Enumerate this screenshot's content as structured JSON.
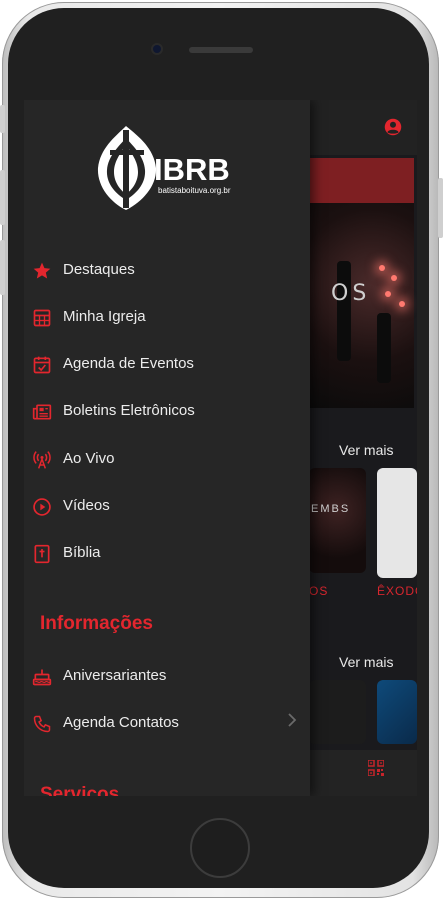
{
  "colors": {
    "accent": "#e3262e",
    "drawer_bg": "#262626",
    "menu_text": "#ececec",
    "app_bg": "#1a1a1d",
    "banner": "#7e1f22"
  },
  "logo": {
    "text": "IBRB",
    "subtext": "batistaboituva.org.br"
  },
  "menu": [
    {
      "label": "Destaques",
      "icon": "star-icon"
    },
    {
      "label": "Minha Igreja",
      "icon": "calendar-grid-icon"
    },
    {
      "label": "Agenda de Eventos",
      "icon": "calendar-check-icon"
    },
    {
      "label": "Boletins Eletrônicos",
      "icon": "newspaper-icon"
    },
    {
      "label": "Ao Vivo",
      "icon": "broadcast-antenna-icon"
    },
    {
      "label": "Vídeos",
      "icon": "play-circle-icon"
    },
    {
      "label": "Bíblia",
      "icon": "bible-icon"
    }
  ],
  "sections": {
    "info_title": "Informações",
    "services_title": "Serviços"
  },
  "info_menu": [
    {
      "label": "Aniversariantes",
      "icon": "birthday-cake-icon"
    },
    {
      "label": "Agenda Contatos",
      "icon": "phone-icon"
    }
  ],
  "background": {
    "hero_text": "OS",
    "see_more_1": "Ver mais",
    "see_more_2": "Ver mais",
    "thumb_label_1": "OS",
    "thumb_label_2": "ÊXODO",
    "thumb_overlay_text": "EMBS",
    "profile_icon": "account-circle-icon",
    "qr_icon": "qr-code-icon"
  }
}
